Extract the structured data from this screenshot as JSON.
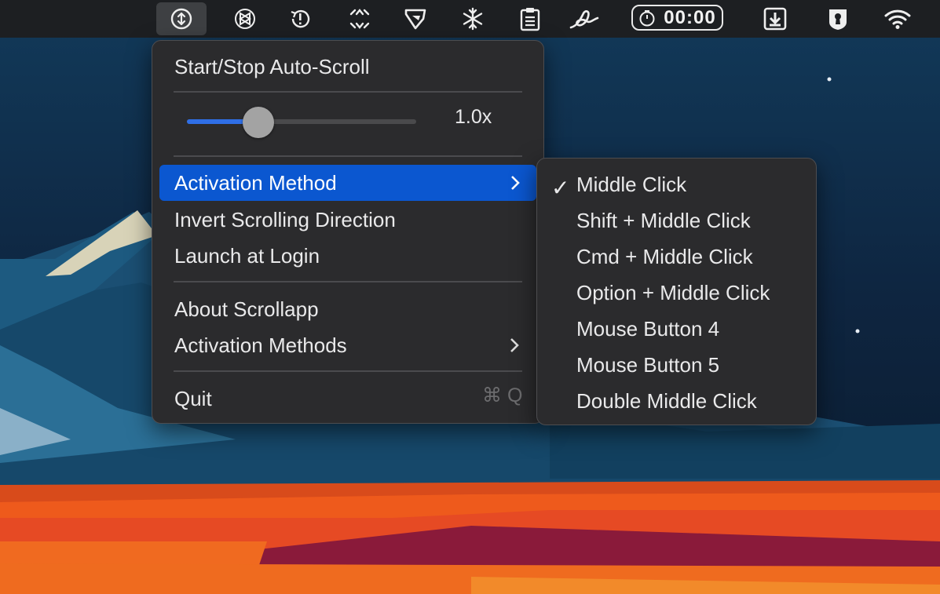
{
  "menubar": {
    "timer_text": "00:00",
    "icons": [
      "scroll-arrows-icon",
      "openai-icon",
      "history-alert-icon",
      "expand-arrows-icon",
      "flag-icon",
      "snowflake-icon",
      "clipboard-icon",
      "signature-icon",
      "timer-icon",
      "download-icon",
      "keyhole-icon",
      "wifi-icon"
    ]
  },
  "main_menu": {
    "start_stop": "Start/Stop Auto-Scroll",
    "speed_value": "1.0x",
    "speed_level": 0.31,
    "activation_method": "Activation Method",
    "invert": "Invert Scrolling Direction",
    "launch": "Launch at Login",
    "about": "About Scrollapp",
    "activation_methods": "Activation Methods",
    "quit": "Quit",
    "quit_shortcut": "⌘ Q"
  },
  "submenu": {
    "checkmark": "✓",
    "items": [
      "Middle Click",
      "Shift + Middle Click",
      "Cmd + Middle Click",
      "Option + Middle Click",
      "Mouse Button 4",
      "Mouse Button 5",
      "Double Middle Click"
    ]
  },
  "colors": {
    "highlight": "#0b57d0",
    "menu_bg": "#2b2b2d",
    "slider_fill": "#2f6fe6"
  }
}
